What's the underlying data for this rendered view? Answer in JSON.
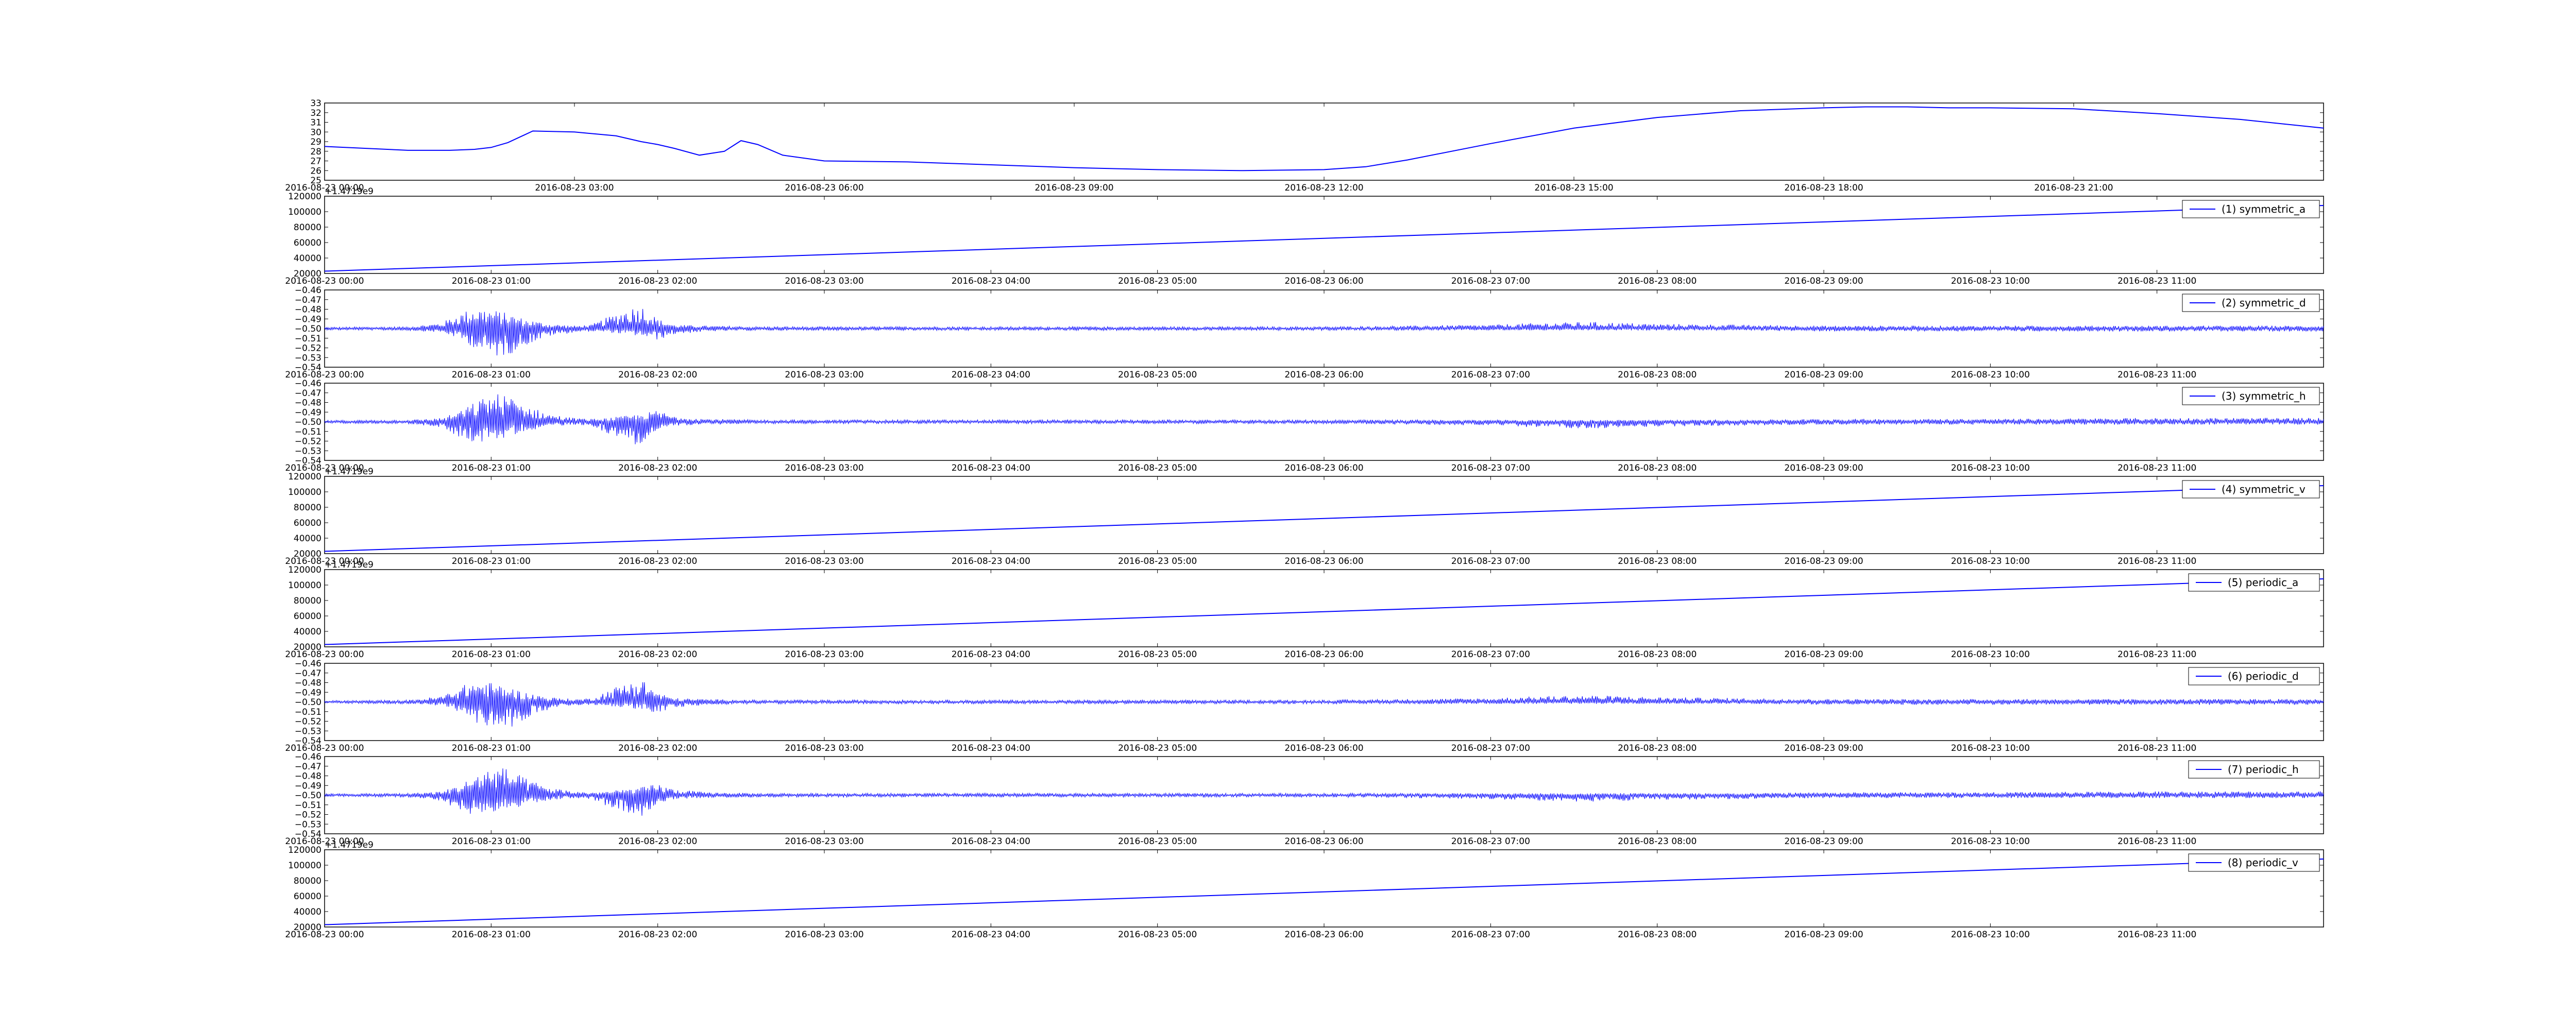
{
  "chart_data": [
    {
      "type": "line",
      "x_kind": "hours",
      "xlim": [
        0,
        24
      ],
      "x_tick_values": [
        3,
        6,
        9,
        12,
        15,
        18,
        21
      ],
      "x_tick_labels": [
        "2016-08-23 03:00",
        "2016-08-23 06:00",
        "2016-08-23 09:00",
        "2016-08-23 12:00",
        "2016-08-23 15:00",
        "2016-08-23 18:00",
        "2016-08-23 21:00"
      ],
      "x_left_label": "2016-08-23 00:00",
      "ylim": [
        25,
        33
      ],
      "y_ticks": [
        25,
        26,
        27,
        28,
        29,
        30,
        31,
        32,
        33
      ],
      "y_tick_labels": [
        "25",
        "26",
        "27",
        "28",
        "29",
        "30",
        "31",
        "32",
        "33"
      ],
      "series": [
        {
          "color": "#0000ff",
          "x": [
            0,
            0.5,
            1,
            1.5,
            1.8,
            2.0,
            2.2,
            2.5,
            3.0,
            3.5,
            3.8,
            4.0,
            4.2,
            4.5,
            4.8,
            5.0,
            5.2,
            5.5,
            6,
            7,
            8,
            9,
            10,
            11,
            12,
            12.5,
            13,
            14,
            15,
            16,
            17,
            18,
            18.5,
            19,
            19.5,
            20,
            21,
            22,
            23,
            24
          ],
          "y": [
            28.5,
            28.3,
            28.1,
            28.1,
            28.2,
            28.4,
            28.9,
            30.1,
            30.0,
            29.6,
            29.0,
            28.7,
            28.3,
            27.6,
            28.0,
            29.1,
            28.7,
            27.6,
            27.0,
            26.9,
            26.6,
            26.3,
            26.1,
            26.0,
            26.1,
            26.4,
            27.1,
            28.8,
            30.4,
            31.5,
            32.2,
            32.5,
            32.6,
            32.6,
            32.5,
            32.5,
            32.4,
            31.9,
            31.3,
            30.4
          ]
        }
      ]
    },
    {
      "type": "line",
      "x_kind": "hours",
      "xlim": [
        0,
        12
      ],
      "x_tick_values": [
        0,
        1,
        2,
        3,
        4,
        5,
        6,
        7,
        8,
        9,
        10,
        11
      ],
      "x_tick_labels": [
        "2016-08-23 00:00",
        "2016-08-23 01:00",
        "2016-08-23 02:00",
        "2016-08-23 03:00",
        "2016-08-23 04:00",
        "2016-08-23 05:00",
        "2016-08-23 06:00",
        "2016-08-23 07:00",
        "2016-08-23 08:00",
        "2016-08-23 09:00",
        "2016-08-23 10:00",
        "2016-08-23 11:00"
      ],
      "offset_text": "+1.4719e9",
      "ylim": [
        20000,
        120000
      ],
      "y_ticks": [
        20000,
        40000,
        60000,
        80000,
        100000,
        120000
      ],
      "y_tick_labels": [
        "20000",
        "40000",
        "60000",
        "80000",
        "100000",
        "120000"
      ],
      "series": [
        {
          "name": "(1) symmetric_a",
          "color": "#0000ff",
          "x": [
            0,
            12
          ],
          "y": [
            23000,
            108000
          ]
        }
      ],
      "legend": "top-right"
    },
    {
      "type": "line",
      "x_kind": "hours",
      "xlim": [
        0,
        12
      ],
      "x_tick_values": [
        0,
        1,
        2,
        3,
        4,
        5,
        6,
        7,
        8,
        9,
        10,
        11
      ],
      "x_tick_labels": [
        "2016-08-23 00:00",
        "2016-08-23 01:00",
        "2016-08-23 02:00",
        "2016-08-23 03:00",
        "2016-08-23 04:00",
        "2016-08-23 05:00",
        "2016-08-23 06:00",
        "2016-08-23 07:00",
        "2016-08-23 08:00",
        "2016-08-23 09:00",
        "2016-08-23 10:00",
        "2016-08-23 11:00"
      ],
      "ylim": [
        -0.54,
        -0.46
      ],
      "y_ticks": [
        -0.54,
        -0.53,
        -0.52,
        -0.51,
        -0.5,
        -0.49,
        -0.48,
        -0.47,
        -0.46
      ],
      "y_tick_labels": [
        "−0.54",
        "−0.53",
        "−0.52",
        "−0.51",
        "−0.50",
        "−0.49",
        "−0.48",
        "−0.47",
        "−0.46"
      ],
      "series": [
        {
          "name": "(2) symmetric_d",
          "color": "#0000ff",
          "center": -0.5,
          "x": [
            0,
            0.5,
            0.7,
            0.8,
            0.9,
            1.0,
            1.1,
            1.2,
            1.35,
            1.5,
            1.6,
            1.7,
            1.8,
            1.9,
            2.0,
            2.1,
            2.3,
            2.6,
            3,
            4,
            5,
            6,
            6.5,
            7.0,
            7.3,
            7.6,
            8.0,
            8.5,
            9,
            10,
            11,
            12
          ],
          "up": [
            0.0015,
            0.002,
            0.006,
            0.015,
            0.022,
            0.02,
            0.016,
            0.01,
            0.005,
            0.003,
            0.004,
            0.012,
            0.02,
            0.025,
            0.01,
            0.004,
            0.003,
            0.002,
            0.002,
            0.002,
            0.002,
            0.002,
            0.003,
            0.004,
            0.006,
            0.007,
            0.005,
            0.004,
            0.003,
            0.003,
            0.003,
            0.003
          ],
          "down": [
            0.0015,
            0.002,
            0.004,
            0.01,
            0.02,
            0.03,
            0.028,
            0.018,
            0.008,
            0.004,
            0.003,
            0.004,
            0.006,
            0.008,
            0.012,
            0.006,
            0.003,
            0.002,
            0.002,
            0.002,
            0.002,
            0.002,
            0.002,
            0.002,
            0.002,
            0.002,
            0.002,
            0.002,
            0.003,
            0.003,
            0.003,
            0.003
          ]
        }
      ],
      "legend": "top-right"
    },
    {
      "type": "line",
      "x_kind": "hours",
      "xlim": [
        0,
        12
      ],
      "x_tick_values": [
        0,
        1,
        2,
        3,
        4,
        5,
        6,
        7,
        8,
        9,
        10,
        11
      ],
      "x_tick_labels": [
        "2016-08-23 00:00",
        "2016-08-23 01:00",
        "2016-08-23 02:00",
        "2016-08-23 03:00",
        "2016-08-23 04:00",
        "2016-08-23 05:00",
        "2016-08-23 06:00",
        "2016-08-23 07:00",
        "2016-08-23 08:00",
        "2016-08-23 09:00",
        "2016-08-23 10:00",
        "2016-08-23 11:00"
      ],
      "ylim": [
        -0.54,
        -0.46
      ],
      "y_ticks": [
        -0.54,
        -0.53,
        -0.52,
        -0.51,
        -0.5,
        -0.49,
        -0.48,
        -0.47,
        -0.46
      ],
      "y_tick_labels": [
        "−0.54",
        "−0.53",
        "−0.52",
        "−0.51",
        "−0.50",
        "−0.49",
        "−0.48",
        "−0.47",
        "−0.46"
      ],
      "series": [
        {
          "name": "(3) symmetric_h",
          "color": "#0000ff",
          "center": -0.5,
          "x": [
            0,
            0.5,
            0.7,
            0.8,
            0.9,
            1.0,
            1.1,
            1.2,
            1.35,
            1.5,
            1.6,
            1.7,
            1.8,
            1.9,
            2.0,
            2.1,
            2.3,
            2.6,
            3,
            4,
            5,
            6,
            6.5,
            7.0,
            7.3,
            7.6,
            8.0,
            8.5,
            9,
            10,
            11,
            12
          ],
          "up": [
            0.0015,
            0.002,
            0.004,
            0.01,
            0.02,
            0.03,
            0.028,
            0.018,
            0.008,
            0.004,
            0.003,
            0.004,
            0.006,
            0.008,
            0.012,
            0.006,
            0.003,
            0.002,
            0.002,
            0.002,
            0.002,
            0.002,
            0.002,
            0.002,
            0.002,
            0.002,
            0.002,
            0.002,
            0.003,
            0.003,
            0.004,
            0.004
          ],
          "down": [
            0.0015,
            0.002,
            0.006,
            0.015,
            0.022,
            0.02,
            0.016,
            0.01,
            0.005,
            0.003,
            0.004,
            0.012,
            0.02,
            0.025,
            0.01,
            0.004,
            0.003,
            0.002,
            0.002,
            0.002,
            0.002,
            0.002,
            0.003,
            0.004,
            0.006,
            0.007,
            0.005,
            0.004,
            0.003,
            0.003,
            0.003,
            0.003
          ]
        }
      ],
      "legend": "top-right"
    },
    {
      "type": "line",
      "x_kind": "hours",
      "xlim": [
        0,
        12
      ],
      "x_tick_values": [
        0,
        1,
        2,
        3,
        4,
        5,
        6,
        7,
        8,
        9,
        10,
        11
      ],
      "x_tick_labels": [
        "2016-08-23 00:00",
        "2016-08-23 01:00",
        "2016-08-23 02:00",
        "2016-08-23 03:00",
        "2016-08-23 04:00",
        "2016-08-23 05:00",
        "2016-08-23 06:00",
        "2016-08-23 07:00",
        "2016-08-23 08:00",
        "2016-08-23 09:00",
        "2016-08-23 10:00",
        "2016-08-23 11:00"
      ],
      "offset_text": "+1.4719e9",
      "ylim": [
        20000,
        120000
      ],
      "y_ticks": [
        20000,
        40000,
        60000,
        80000,
        100000,
        120000
      ],
      "y_tick_labels": [
        "20000",
        "40000",
        "60000",
        "80000",
        "100000",
        "120000"
      ],
      "series": [
        {
          "name": "(4) symmetric_v",
          "color": "#0000ff",
          "x": [
            0,
            12
          ],
          "y": [
            23000,
            108000
          ]
        }
      ],
      "legend": "top-right"
    },
    {
      "type": "line",
      "x_kind": "hours",
      "xlim": [
        0,
        12
      ],
      "x_tick_values": [
        0,
        1,
        2,
        3,
        4,
        5,
        6,
        7,
        8,
        9,
        10,
        11
      ],
      "x_tick_labels": [
        "2016-08-23 00:00",
        "2016-08-23 01:00",
        "2016-08-23 02:00",
        "2016-08-23 03:00",
        "2016-08-23 04:00",
        "2016-08-23 05:00",
        "2016-08-23 06:00",
        "2016-08-23 07:00",
        "2016-08-23 08:00",
        "2016-08-23 09:00",
        "2016-08-23 10:00",
        "2016-08-23 11:00"
      ],
      "offset_text": "+1.4719e9",
      "ylim": [
        20000,
        120000
      ],
      "y_ticks": [
        20000,
        40000,
        60000,
        80000,
        100000,
        120000
      ],
      "y_tick_labels": [
        "20000",
        "40000",
        "60000",
        "80000",
        "100000",
        "120000"
      ],
      "series": [
        {
          "name": "(5) periodic_a",
          "color": "#0000ff",
          "x": [
            0,
            12
          ],
          "y": [
            23000,
            108000
          ]
        }
      ],
      "legend": "top-right"
    },
    {
      "type": "line",
      "x_kind": "hours",
      "xlim": [
        0,
        12
      ],
      "x_tick_values": [
        0,
        1,
        2,
        3,
        4,
        5,
        6,
        7,
        8,
        9,
        10,
        11
      ],
      "x_tick_labels": [
        "2016-08-23 00:00",
        "2016-08-23 01:00",
        "2016-08-23 02:00",
        "2016-08-23 03:00",
        "2016-08-23 04:00",
        "2016-08-23 05:00",
        "2016-08-23 06:00",
        "2016-08-23 07:00",
        "2016-08-23 08:00",
        "2016-08-23 09:00",
        "2016-08-23 10:00",
        "2016-08-23 11:00"
      ],
      "ylim": [
        -0.54,
        -0.46
      ],
      "y_ticks": [
        -0.54,
        -0.53,
        -0.52,
        -0.51,
        -0.5,
        -0.49,
        -0.48,
        -0.47,
        -0.46
      ],
      "y_tick_labels": [
        "−0.54",
        "−0.53",
        "−0.52",
        "−0.51",
        "−0.50",
        "−0.49",
        "−0.48",
        "−0.47",
        "−0.46"
      ],
      "series": [
        {
          "name": "(6) periodic_d",
          "color": "#0000ff",
          "center": -0.5,
          "x": [
            0,
            0.5,
            0.7,
            0.8,
            0.9,
            1.0,
            1.1,
            1.2,
            1.35,
            1.5,
            1.6,
            1.7,
            1.8,
            1.9,
            2.0,
            2.1,
            2.3,
            2.6,
            3,
            4,
            5,
            6,
            6.5,
            7.0,
            7.3,
            7.6,
            8.0,
            8.5,
            9,
            10,
            11,
            12
          ],
          "up": [
            0.0015,
            0.002,
            0.006,
            0.015,
            0.022,
            0.02,
            0.016,
            0.01,
            0.005,
            0.003,
            0.004,
            0.012,
            0.02,
            0.025,
            0.01,
            0.004,
            0.003,
            0.002,
            0.002,
            0.002,
            0.002,
            0.002,
            0.003,
            0.004,
            0.006,
            0.007,
            0.005,
            0.004,
            0.003,
            0.003,
            0.003,
            0.003
          ],
          "down": [
            0.0015,
            0.002,
            0.004,
            0.01,
            0.02,
            0.03,
            0.028,
            0.018,
            0.008,
            0.004,
            0.003,
            0.004,
            0.006,
            0.008,
            0.012,
            0.006,
            0.003,
            0.002,
            0.002,
            0.002,
            0.002,
            0.002,
            0.002,
            0.002,
            0.002,
            0.002,
            0.002,
            0.002,
            0.003,
            0.003,
            0.003,
            0.003
          ]
        }
      ],
      "legend": "top-right"
    },
    {
      "type": "line",
      "x_kind": "hours",
      "xlim": [
        0,
        12
      ],
      "x_tick_values": [
        0,
        1,
        2,
        3,
        4,
        5,
        6,
        7,
        8,
        9,
        10,
        11
      ],
      "x_tick_labels": [
        "2016-08-23 00:00",
        "2016-08-23 01:00",
        "2016-08-23 02:00",
        "2016-08-23 03:00",
        "2016-08-23 04:00",
        "2016-08-23 05:00",
        "2016-08-23 06:00",
        "2016-08-23 07:00",
        "2016-08-23 08:00",
        "2016-08-23 09:00",
        "2016-08-23 10:00",
        "2016-08-23 11:00"
      ],
      "ylim": [
        -0.54,
        -0.46
      ],
      "y_ticks": [
        -0.54,
        -0.53,
        -0.52,
        -0.51,
        -0.5,
        -0.49,
        -0.48,
        -0.47,
        -0.46
      ],
      "y_tick_labels": [
        "−0.54",
        "−0.53",
        "−0.52",
        "−0.51",
        "−0.50",
        "−0.49",
        "−0.48",
        "−0.47",
        "−0.46"
      ],
      "series": [
        {
          "name": "(7) periodic_h",
          "color": "#0000ff",
          "center": -0.5,
          "x": [
            0,
            0.5,
            0.7,
            0.8,
            0.9,
            1.0,
            1.1,
            1.2,
            1.35,
            1.5,
            1.6,
            1.7,
            1.8,
            1.9,
            2.0,
            2.1,
            2.3,
            2.6,
            3,
            4,
            5,
            6,
            6.5,
            7.0,
            7.3,
            7.6,
            8.0,
            8.5,
            9,
            10,
            11,
            12
          ],
          "up": [
            0.0015,
            0.002,
            0.004,
            0.01,
            0.02,
            0.03,
            0.028,
            0.018,
            0.008,
            0.004,
            0.003,
            0.004,
            0.006,
            0.008,
            0.012,
            0.006,
            0.003,
            0.002,
            0.002,
            0.002,
            0.002,
            0.002,
            0.002,
            0.002,
            0.002,
            0.002,
            0.002,
            0.002,
            0.003,
            0.003,
            0.004,
            0.004
          ],
          "down": [
            0.0015,
            0.002,
            0.006,
            0.015,
            0.022,
            0.02,
            0.016,
            0.01,
            0.005,
            0.003,
            0.004,
            0.012,
            0.02,
            0.025,
            0.01,
            0.004,
            0.003,
            0.002,
            0.002,
            0.002,
            0.002,
            0.002,
            0.003,
            0.004,
            0.006,
            0.007,
            0.005,
            0.004,
            0.003,
            0.003,
            0.003,
            0.003
          ]
        }
      ],
      "legend": "top-right"
    },
    {
      "type": "line",
      "x_kind": "hours",
      "xlim": [
        0,
        12
      ],
      "x_tick_values": [
        0,
        1,
        2,
        3,
        4,
        5,
        6,
        7,
        8,
        9,
        10,
        11
      ],
      "x_tick_labels": [
        "2016-08-23 00:00",
        "2016-08-23 01:00",
        "2016-08-23 02:00",
        "2016-08-23 03:00",
        "2016-08-23 04:00",
        "2016-08-23 05:00",
        "2016-08-23 06:00",
        "2016-08-23 07:00",
        "2016-08-23 08:00",
        "2016-08-23 09:00",
        "2016-08-23 10:00",
        "2016-08-23 11:00"
      ],
      "offset_text": "+1.4719e9",
      "ylim": [
        20000,
        120000
      ],
      "y_ticks": [
        20000,
        40000,
        60000,
        80000,
        100000,
        120000
      ],
      "y_tick_labels": [
        "20000",
        "40000",
        "60000",
        "80000",
        "100000",
        "120000"
      ],
      "series": [
        {
          "name": "(8) periodic_v",
          "color": "#0000ff",
          "x": [
            0,
            12
          ],
          "y": [
            23000,
            108000
          ]
        }
      ],
      "legend": "top-right"
    }
  ]
}
